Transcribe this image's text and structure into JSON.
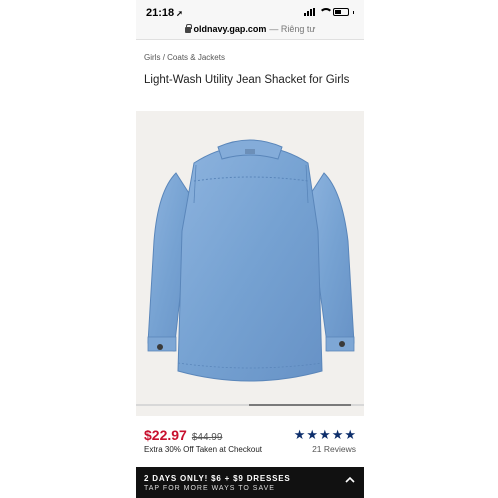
{
  "status_bar": {
    "time": "21:18",
    "location_arrow": "location-arrow-icon"
  },
  "browser": {
    "domain": "oldnavy.gap.com",
    "private_label": "— Riêng tư"
  },
  "breadcrumb": {
    "parent": "Girls",
    "separator": "/",
    "current": "Coats & Jackets"
  },
  "product": {
    "title": "Light-Wash Utility Jean Shacket for Girls",
    "sale_price": "$22.97",
    "original_price": "$44.99",
    "promo_text": "Extra 30% Off Taken at Checkout",
    "rating": 5,
    "reviews": "21 Reviews"
  },
  "banner": {
    "headline": "2 DAYS ONLY! $6 + $9 DRESSES",
    "subline": "TAP FOR MORE WAYS TO SAVE",
    "icon": "chevron-up-icon"
  },
  "colors": {
    "sale": "#c8102e",
    "star": "#0d2e6b",
    "banner_bg": "#111111",
    "denim": "#7aa4d2"
  }
}
